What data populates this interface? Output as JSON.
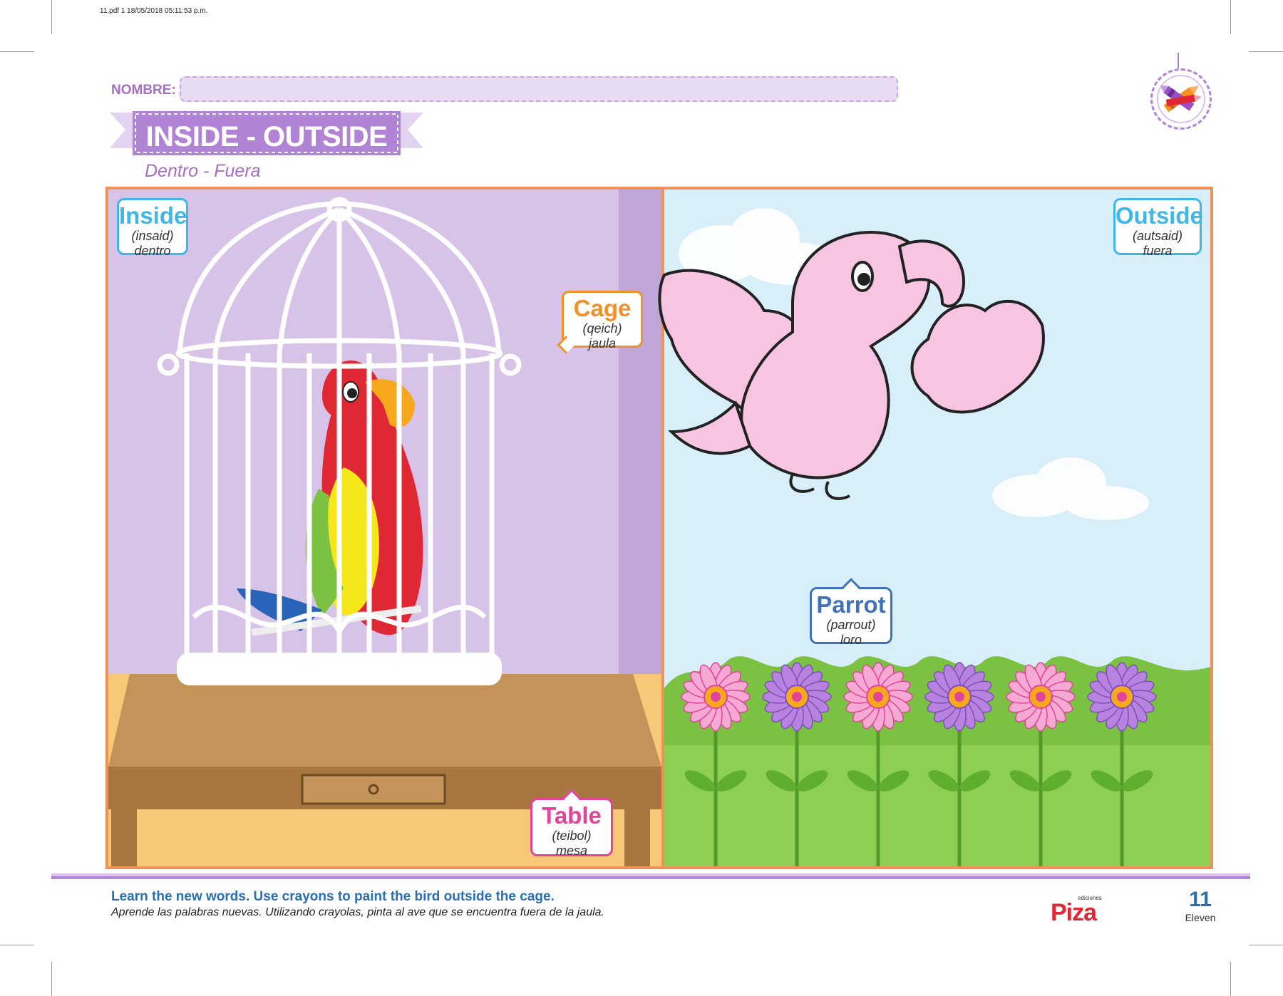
{
  "print_meta": "11.pdf   1   18/05/2018   05:11:53 p.m.",
  "name_label": "NOMBRE:",
  "title": "INSIDE - OUTSIDE",
  "subtitle": "Dentro - Fuera",
  "labels": {
    "inside": {
      "word": "Inside",
      "pron": "(insaid)",
      "trans": "dentro",
      "color": "#3fb8e8"
    },
    "outside": {
      "word": "Outside",
      "pron": "(autsaid)",
      "trans": "fuera",
      "color": "#3fb8e8"
    },
    "cage": {
      "word": "Cage",
      "pron": "(qeich)",
      "trans": "jaula",
      "color": "#f0912a"
    },
    "parrot": {
      "word": "Parrot",
      "pron": "(parrout)",
      "trans": "loro",
      "color": "#3f72b8"
    },
    "table": {
      "word": "Table",
      "pron": "(teibol)",
      "trans": "mesa",
      "color": "#e0459a"
    }
  },
  "instructions": {
    "en": "Learn the new words. Use crayons to paint the bird outside the cage.",
    "es": "Aprende las palabras nuevas. Utilizando crayolas, pinta al ave que se encuentra fuera de la jaula."
  },
  "publisher": {
    "small": "ediciones",
    "name": "Piza"
  },
  "page": {
    "number": "11",
    "word": "Eleven"
  },
  "colors": {
    "accent": "#a56fc3",
    "frame": "#f0915a",
    "wall": "#d8c3e8",
    "sky": "#d8eff9",
    "grass": "#7cc242"
  },
  "icons": [
    "crayon-icon",
    "cage-illustration",
    "parrot-illustration",
    "flower-illustration",
    "cloud-illustration"
  ]
}
